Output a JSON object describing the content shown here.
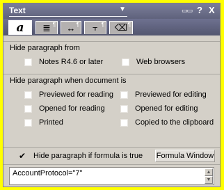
{
  "titlebar": {
    "title": "Text",
    "dropdown_icon": "triangle-down",
    "icons": [
      {
        "name": "help-icon",
        "glyph": "?"
      },
      {
        "name": "close-icon",
        "glyph": "X"
      }
    ]
  },
  "tabs": [
    {
      "name": "font",
      "icon": "italic-a-icon",
      "glyph": "a",
      "active": true
    },
    {
      "name": "paragraph",
      "icon": "paragraph-lines-icon",
      "glyph": "≣",
      "active": false
    },
    {
      "name": "margins",
      "icon": "margin-arrows-icon",
      "glyph": "↔",
      "active": false
    },
    {
      "name": "tabs",
      "icon": "tab-stops-icon",
      "glyph": "⫟",
      "active": false
    },
    {
      "name": "hide-when",
      "icon": "eraser-icon",
      "glyph": "⌫",
      "active": false
    }
  ],
  "hide_from": {
    "heading": "Hide paragraph from",
    "options": [
      {
        "label": "Notes R4.6 or later",
        "checked": false
      },
      {
        "label": "Web browsers",
        "checked": false
      }
    ]
  },
  "hide_when": {
    "heading": "Hide paragraph when document is",
    "options": [
      {
        "label": "Previewed for reading",
        "checked": false
      },
      {
        "label": "Previewed for editing",
        "checked": false
      },
      {
        "label": "Opened for reading",
        "checked": false
      },
      {
        "label": "Opened for editing",
        "checked": false
      },
      {
        "label": "Printed",
        "checked": false
      },
      {
        "label": "Copied to the clipboard",
        "checked": false
      }
    ]
  },
  "formula": {
    "checkbox_label": "Hide paragraph if formula is true",
    "checked": true,
    "check_glyph": "✔",
    "window_button": "Formula Window",
    "text": "AccountProtocol=\"7\""
  },
  "colors": {
    "background": "#ffff00",
    "panel": "#d4d0c8",
    "titlebar": "#656882"
  }
}
